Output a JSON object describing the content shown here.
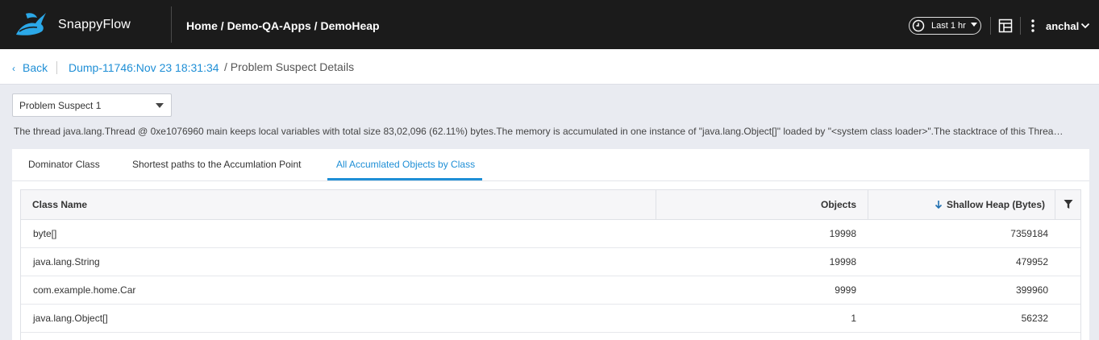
{
  "header": {
    "brand": "SnappyFlow",
    "breadcrumb": "Home / Demo-QA-Apps / DemoHeap",
    "time_range": "Last 1 hr",
    "user": "anchal"
  },
  "subheader": {
    "back_label": "Back",
    "dump_link": "Dump-11746:Nov 23 18:31:34",
    "crumb_tail": "/ Problem Suspect Details"
  },
  "suspect_select": {
    "value": "Problem Suspect 1"
  },
  "description": "The thread java.lang.Thread @ 0xe1076960 main keeps local variables with total size 83,02,096 (62.11%) bytes.The memory is accumulated in one instance of \"java.lang.Object[]\" loaded by \"<system class loader>\".The stacktrace of this Thread i...",
  "tabs": [
    {
      "label": "Dominator Class",
      "active": false
    },
    {
      "label": "Shortest paths to the Accumlation Point",
      "active": false
    },
    {
      "label": "All Accumlated Objects by Class",
      "active": true
    }
  ],
  "table": {
    "columns": [
      "Class Name",
      "Objects",
      "Shallow Heap (Bytes)"
    ],
    "sort": {
      "column": "Shallow Heap (Bytes)",
      "direction": "desc"
    },
    "rows": [
      {
        "class_name": "byte[]",
        "objects": "19998",
        "shallow_heap": "7359184"
      },
      {
        "class_name": "java.lang.String",
        "objects": "19998",
        "shallow_heap": "479952"
      },
      {
        "class_name": "com.example.home.Car",
        "objects": "9999",
        "shallow_heap": "399960"
      },
      {
        "class_name": "java.lang.Object[]",
        "objects": "1",
        "shallow_heap": "56232"
      }
    ]
  },
  "colors": {
    "accent": "#1f8fd6",
    "topbar": "#1b1b1b",
    "page_bg": "#e9ebf1"
  }
}
